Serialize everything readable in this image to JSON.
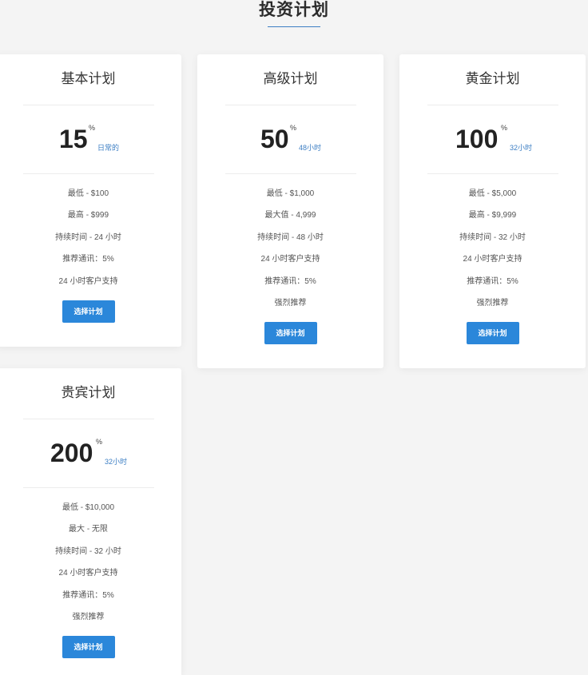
{
  "page": {
    "title": "投资计划"
  },
  "plans": [
    {
      "name": "基本计划",
      "rate": "15",
      "percent": "%",
      "period": "日常的",
      "features": [
        "最低 - $100",
        "最高 - $999",
        "持续时间 - 24 小时",
        "推荐通讯：5%",
        "24 小时客户支持"
      ],
      "button": "选择计划"
    },
    {
      "name": "高级计划",
      "rate": "50",
      "percent": "%",
      "period": "48小时",
      "features": [
        "最低 - $1,000",
        "最大值 - 4,999",
        "持续时间 - 48 小时",
        "24 小时客户支持",
        "推荐通讯：5%",
        "强烈推荐"
      ],
      "button": "选择计划"
    },
    {
      "name": "黄金计划",
      "rate": "100",
      "percent": "%",
      "period": "32小时",
      "features": [
        "最低 - $5,000",
        "最高 - $9,999",
        "持续时间 - 32 小时",
        "24 小时客户支持",
        "推荐通讯：5%",
        "强烈推荐"
      ],
      "button": "选择计划"
    },
    {
      "name": "贵宾计划",
      "rate": "200",
      "percent": "%",
      "period": "32小时",
      "features": [
        "最低 - $10,000",
        "最大 - 无限",
        "持续时间 - 32 小时",
        "24 小时客户支持",
        "推荐通讯：5%",
        "强烈推荐"
      ],
      "button": "选择计划"
    }
  ],
  "colors": {
    "accent": "#2b87da",
    "period_text": "#3d7fc4",
    "background": "#f4f4f4",
    "card": "#ffffff"
  }
}
